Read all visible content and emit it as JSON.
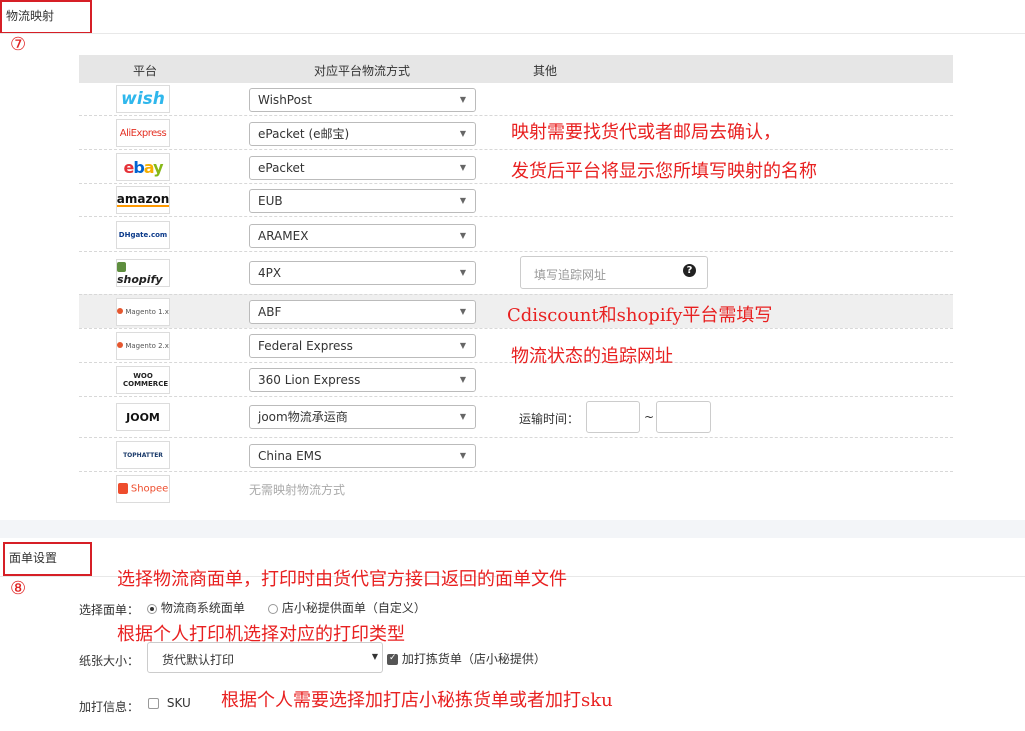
{
  "mapping_section": {
    "title": "物流映射",
    "number": "⑦",
    "headers": {
      "platform": "平台",
      "method": "对应平台物流方式",
      "other": "其他"
    },
    "rows": [
      {
        "logo": "wish",
        "method": "WishPost"
      },
      {
        "logo": "AliExpress",
        "method": "ePacket (e邮宝)"
      },
      {
        "logo": "ebay",
        "method": "ePacket"
      },
      {
        "logo": "amazon",
        "method": "EUB"
      },
      {
        "logo": "DHgate.com",
        "method": "ARAMEX"
      },
      {
        "logo": "shopify",
        "method": "4PX"
      },
      {
        "logo": "Magento 1.x",
        "method": "ABF"
      },
      {
        "logo": "Magento 2.x",
        "method": "Federal Express"
      },
      {
        "logo": "WOO COMMERCE",
        "method": "360 Lion Express"
      },
      {
        "logo": "JOOM",
        "method": "joom物流承运商"
      },
      {
        "logo": "TOPHATTER",
        "method": "China EMS"
      },
      {
        "logo": "Shopee",
        "method": "无需映射物流方式"
      }
    ],
    "tracking_url_placeholder": "填写追踪网址",
    "transit_time_label": "运输时间：",
    "transit_sep": "~",
    "notes": {
      "note1": "映射需要找货代或者邮局去确认，",
      "note2": "发货后平台将显示您所填写映射的名称",
      "note3": "Cdiscount和shopify平台需填写",
      "note4": "物流状态的追踪网址"
    }
  },
  "label_section": {
    "title": "面单设置",
    "number": "⑧",
    "note_top": "选择物流商面单，打印时由货代官方接口返回的面单文件",
    "select_label": "选择面单：",
    "option1": "物流商系统面单",
    "option2": "店小秘提供面单（自定义）",
    "note_printer": "根据个人打印机选择对应的打印类型",
    "paper_label": "纸张大小：",
    "paper_value": "货代默认打印",
    "pick_list_label": "加打拣货单（店小秘提供）",
    "extra_label": "加打信息：",
    "sku_label": "SKU",
    "note_extra": "根据个人需要选择加打店小秘拣货单或者加打sku"
  },
  "colors": {
    "annotation_red": "#e82020",
    "box_red": "#d61f26",
    "header_gray": "#e6e6e6"
  }
}
